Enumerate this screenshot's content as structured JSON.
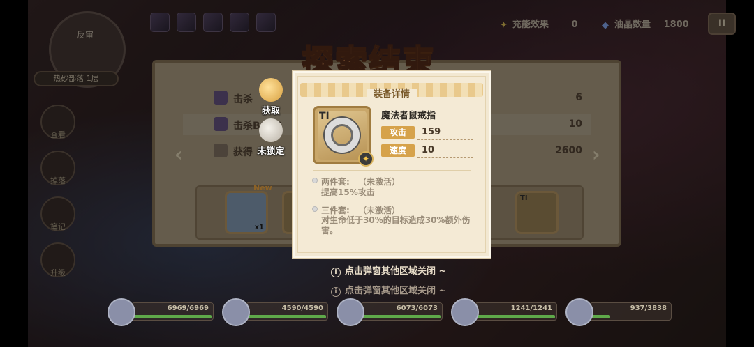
{
  "screen": {
    "banner": "探索结束"
  },
  "hud": {
    "energy_label": "充能效果",
    "energy_value": "0",
    "crystal_label": "油晶数量",
    "crystal_value": "1800",
    "pause_label": "II"
  },
  "map": {
    "badge_label": "反审",
    "floor_label": "热砂部落 1层"
  },
  "nav": [
    {
      "label": "查看"
    },
    {
      "label": "掉落"
    },
    {
      "label": "笔记"
    },
    {
      "label": "升级"
    }
  ],
  "summary": {
    "rows": [
      {
        "label": "击杀",
        "value": "6"
      },
      {
        "label": "击杀BOSS",
        "value": "10"
      },
      {
        "label": "获得",
        "value": "2600"
      }
    ],
    "items": [
      {
        "new_tag": "New",
        "qty": "x1"
      },
      {
        "tier": "TI"
      }
    ]
  },
  "actions": {
    "get_label": "获取",
    "unlock_label": "未锁定"
  },
  "equipment": {
    "header": "装备详情",
    "tier": "TI",
    "name": "魔法者鼠戒指",
    "stats": [
      {
        "key": "攻击",
        "value": "159"
      },
      {
        "key": "速度",
        "value": "10"
      }
    ],
    "set2_label": "两件套:",
    "set2_status": "（未激活）",
    "set2_desc": "提高15%攻击",
    "set3_label": "三件套:",
    "set3_status": "（未激活）",
    "set3_desc": "对生命低于30%的目标造成30%额外伤害。"
  },
  "hints": [
    "点击弹窗其他区域关闭 ~",
    "点击弹窗其他区域关闭 ~"
  ],
  "party": [
    {
      "hp": "6969/6969",
      "fill": 1.0
    },
    {
      "hp": "4590/4590",
      "fill": 1.0
    },
    {
      "hp": "6073/6073",
      "fill": 1.0
    },
    {
      "hp": "1241/1241",
      "fill": 1.0
    },
    {
      "hp": "937/3838",
      "fill": 0.24
    }
  ],
  "colors": {
    "accent": "#d6a24a",
    "hp_green": "#5fa94a",
    "banner": "#c07a4a"
  }
}
